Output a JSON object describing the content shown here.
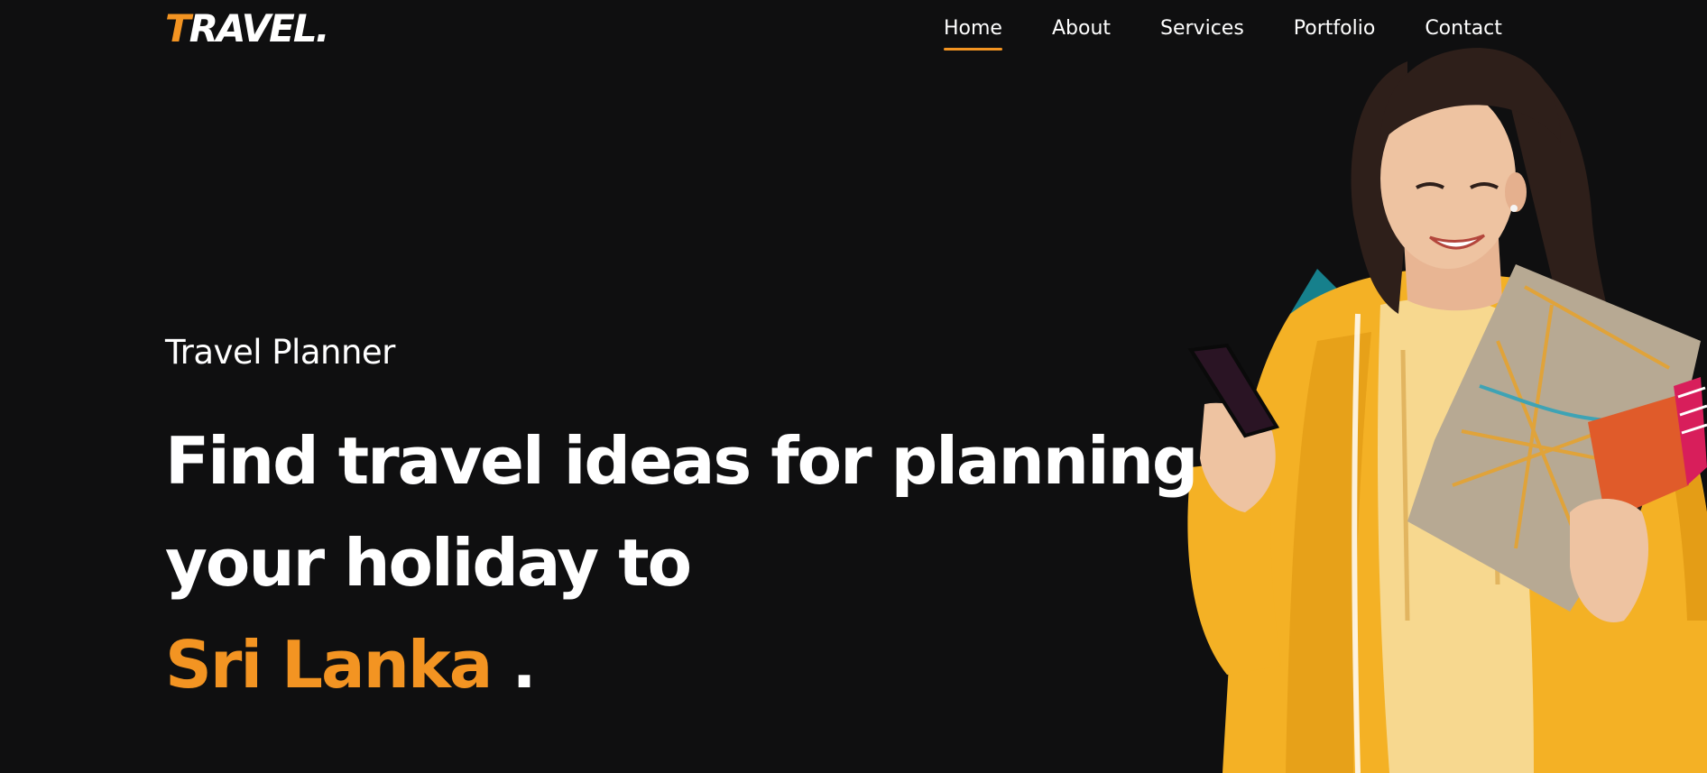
{
  "header": {
    "logo_first_letter": "T",
    "logo_rest": "RAVEL.",
    "nav": [
      {
        "label": "Home",
        "active": true
      },
      {
        "label": "About",
        "active": false
      },
      {
        "label": "Services",
        "active": false
      },
      {
        "label": "Portfolio",
        "active": false
      },
      {
        "label": "Contact",
        "active": false
      }
    ]
  },
  "hero": {
    "eyebrow": "Travel Planner",
    "headline_line1": "Find travel ideas for planning",
    "headline_line2": "your holiday to",
    "headline_accent": "Sri Lanka",
    "headline_dot": "."
  },
  "colors": {
    "background": "#0f0f10",
    "accent": "#f39422",
    "text": "#ffffff"
  },
  "icons": {
    "hero_image": "woman-traveler-with-phone-map-passport"
  }
}
